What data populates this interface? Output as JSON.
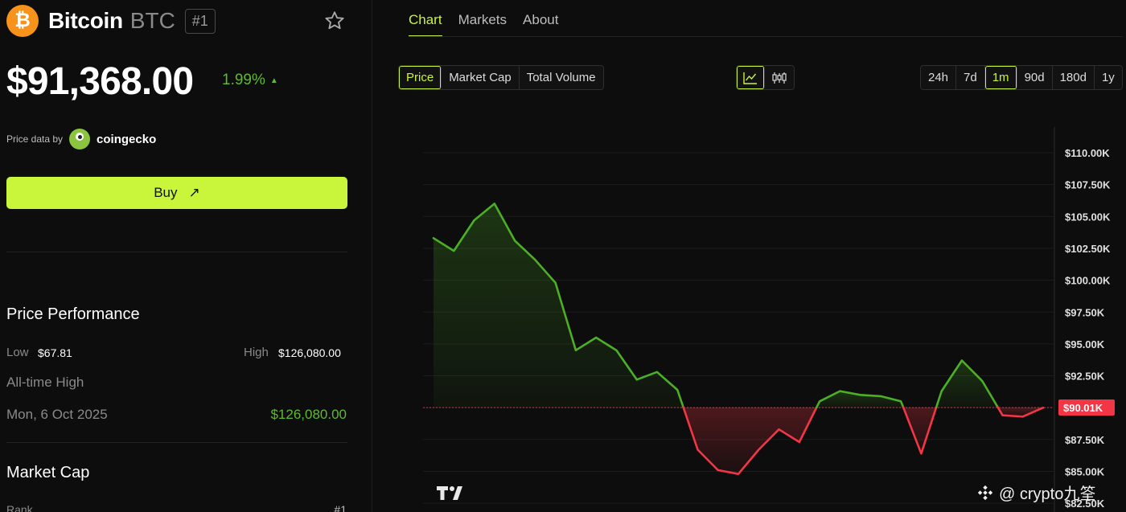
{
  "coin": {
    "logo_glyph": "₿",
    "name": "Bitcoin",
    "symbol": "BTC",
    "rank": "#1",
    "price": "$91,368.00",
    "change": "1.99%",
    "change_arrow": "▲",
    "change_color": "#5fb931",
    "logo_color": "#f7931a"
  },
  "price_data": {
    "label": "Price data by",
    "provider": "coingecko"
  },
  "buy": {
    "label": "Buy",
    "arrow": "↗",
    "color": "#c9f53b"
  },
  "performance": {
    "title": "Price Performance",
    "low_label": "Low",
    "low_value": "$67.81",
    "high_label": "High",
    "high_value": "$126,080.00",
    "ath_label": "All-time High",
    "ath_date": "Mon, 6 Oct 2025",
    "ath_value": "$126,080.00"
  },
  "market_cap": {
    "title": "Market Cap",
    "rank_label": "Rank",
    "rank_value": "#1"
  },
  "tabs": [
    {
      "label": "Chart",
      "active": true
    },
    {
      "label": "Markets",
      "active": false
    },
    {
      "label": "About",
      "active": false
    }
  ],
  "metric_options": [
    {
      "label": "Price",
      "active": true
    },
    {
      "label": "Market Cap",
      "active": false
    },
    {
      "label": "Total Volume",
      "active": false
    }
  ],
  "chart_types": [
    {
      "icon": "line-chart-icon",
      "active": true
    },
    {
      "icon": "candlestick-icon",
      "active": false
    }
  ],
  "ranges": [
    {
      "label": "24h",
      "active": false
    },
    {
      "label": "7d",
      "active": false
    },
    {
      "label": "1m",
      "active": true
    },
    {
      "label": "90d",
      "active": false
    },
    {
      "label": "180d",
      "active": false
    },
    {
      "label": "1y",
      "active": false
    }
  ],
  "watermark": "@ crypto九筌",
  "chart_data": {
    "type": "line",
    "y_ticks": [
      110000,
      107500,
      105000,
      102500,
      100000,
      97500,
      95000,
      92500,
      90000,
      87500,
      85000,
      82500
    ],
    "y_tick_labels": [
      "$110.00K",
      "$107.50K",
      "$105.00K",
      "$102.50K",
      "$100.00K",
      "$97.50K",
      "$95.00K",
      "$92.50K",
      "$90.00K",
      "$87.50K",
      "$85.00K",
      "$82.50K"
    ],
    "ylim": [
      82000,
      112000
    ],
    "baseline": 90010,
    "baseline_label": "$90.01K",
    "up_color": "#4caf26",
    "down_color": "#f23645",
    "values": [
      103300,
      102300,
      104700,
      106000,
      103100,
      101600,
      99800,
      94500,
      95500,
      94500,
      92200,
      92800,
      91400,
      86700,
      85100,
      84800,
      86700,
      88300,
      87300,
      90500,
      91300,
      91000,
      90900,
      90500,
      86400,
      91300,
      93700,
      92100,
      89400,
      89300,
      90000
    ]
  }
}
